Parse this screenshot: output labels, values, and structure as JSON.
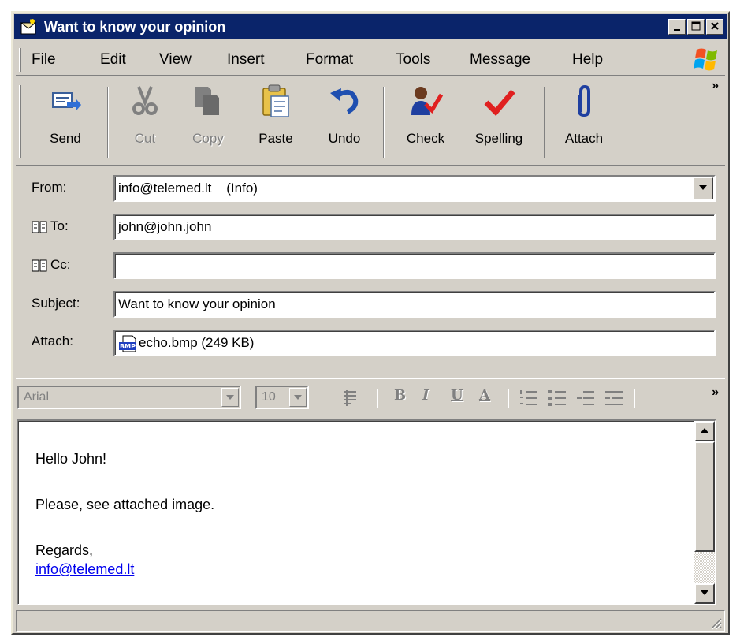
{
  "window": {
    "title": "Want to know your opinion"
  },
  "menu": [
    {
      "label": "File",
      "mnemonic": "F"
    },
    {
      "label": "Edit",
      "mnemonic": "E"
    },
    {
      "label": "View",
      "mnemonic": "V"
    },
    {
      "label": "Insert",
      "mnemonic": "I"
    },
    {
      "label": "Format",
      "mnemonic": "o"
    },
    {
      "label": "Tools",
      "mnemonic": "T"
    },
    {
      "label": "Message",
      "mnemonic": "M"
    },
    {
      "label": "Help",
      "mnemonic": "H"
    }
  ],
  "toolbar": {
    "send": "Send",
    "cut": "Cut",
    "copy": "Copy",
    "paste": "Paste",
    "undo": "Undo",
    "check": "Check",
    "spelling": "Spelling",
    "attach": "Attach",
    "more": "»"
  },
  "header": {
    "from_label": "From:",
    "from_value": "info@telemed.lt    (Info)",
    "to_label": "To:",
    "to_value": "john@john.john",
    "cc_label": "Cc:",
    "cc_value": "",
    "subject_label": "Subject:",
    "subject_value": "Want to know your opinion",
    "attach_label": "Attach:",
    "attach_value": "echo.bmp (249 KB)",
    "attach_icon_text": "BMP"
  },
  "format": {
    "font": "Arial",
    "size": "10",
    "bold": "B",
    "italic": "I",
    "underline": "U",
    "color": "A",
    "more": "»"
  },
  "message": {
    "greeting": "Hello John!",
    "line1": "Please, see attached image.",
    "closing": "Regards,",
    "signature_link": "info@telemed.lt"
  },
  "colors": {
    "title_bar": "#0a246a",
    "face": "#d4d0c8",
    "link": "#0000ee"
  }
}
